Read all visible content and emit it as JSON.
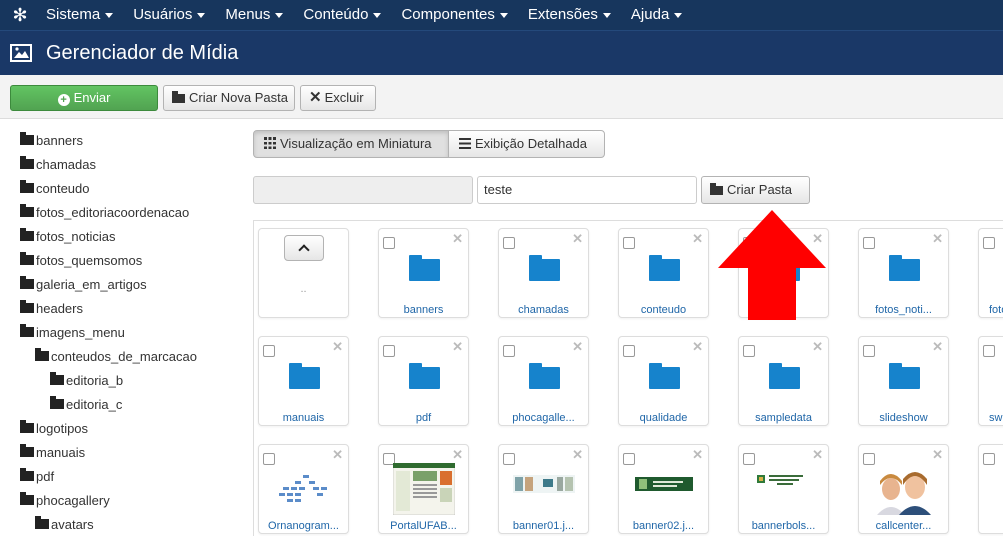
{
  "nav": {
    "logo_icon": "joomla-icon",
    "menu": [
      "Sistema",
      "Usuários",
      "Menus",
      "Conteúdo",
      "Componentes",
      "Extensões",
      "Ajuda"
    ]
  },
  "title": {
    "icon": "image-icon",
    "text": "Gerenciador de Mídia"
  },
  "toolbar": {
    "upload_label": "Enviar",
    "new_folder_label": "Criar Nova Pasta",
    "delete_label": "Excluir"
  },
  "tree": [
    {
      "label": "banners",
      "level": 0
    },
    {
      "label": "chamadas",
      "level": 0
    },
    {
      "label": "conteudo",
      "level": 0
    },
    {
      "label": "fotos_editoriacoordenacao",
      "level": 0
    },
    {
      "label": "fotos_noticias",
      "level": 0
    },
    {
      "label": "fotos_quemsomos",
      "level": 0
    },
    {
      "label": "galeria_em_artigos",
      "level": 0
    },
    {
      "label": "headers",
      "level": 0
    },
    {
      "label": "imagens_menu",
      "level": 0
    },
    {
      "label": "conteudos_de_marcacao",
      "level": 1
    },
    {
      "label": "editoria_b",
      "level": 2
    },
    {
      "label": "editoria_c",
      "level": 2
    },
    {
      "label": "logotipos",
      "level": 0
    },
    {
      "label": "manuais",
      "level": 0
    },
    {
      "label": "pdf",
      "level": 0
    },
    {
      "label": "phocagallery",
      "level": 0
    },
    {
      "label": "avatars",
      "level": 1
    }
  ],
  "view": {
    "thumbs_label": "Visualização em Miniatura",
    "detail_label": "Exibição Detalhada"
  },
  "folder_form": {
    "path_value": "",
    "name_value": "teste",
    "create_label": "Criar Pasta"
  },
  "thumbnails": {
    "up_label": "..",
    "items": [
      {
        "label": "banners",
        "kind": "folder"
      },
      {
        "label": "chamadas",
        "kind": "folder"
      },
      {
        "label": "conteudo",
        "kind": "folder"
      },
      {
        "label": "",
        "kind": "folder"
      },
      {
        "label": "fotos_noti...",
        "kind": "folder"
      },
      {
        "label": "foto",
        "kind": "folder"
      },
      {
        "label": "manuais",
        "kind": "folder"
      },
      {
        "label": "pdf",
        "kind": "folder"
      },
      {
        "label": "phocagalle...",
        "kind": "folder"
      },
      {
        "label": "qualidade",
        "kind": "folder"
      },
      {
        "label": "sampledata",
        "kind": "folder"
      },
      {
        "label": "slideshow",
        "kind": "folder"
      },
      {
        "label": "sw",
        "kind": "folder"
      },
      {
        "label": "Ornanogram...",
        "kind": "image"
      },
      {
        "label": "PortalUFAB...",
        "kind": "image"
      },
      {
        "label": "banner01.j...",
        "kind": "image"
      },
      {
        "label": "banner02.j...",
        "kind": "image"
      },
      {
        "label": "bannerbols...",
        "kind": "image"
      },
      {
        "label": "callcenter...",
        "kind": "image"
      }
    ]
  },
  "colors": {
    "nav_bg": "#17365d",
    "title_bg": "#1a3867",
    "success": "#51a351",
    "folder": "#1683cc",
    "arrow": "#ff0000"
  }
}
